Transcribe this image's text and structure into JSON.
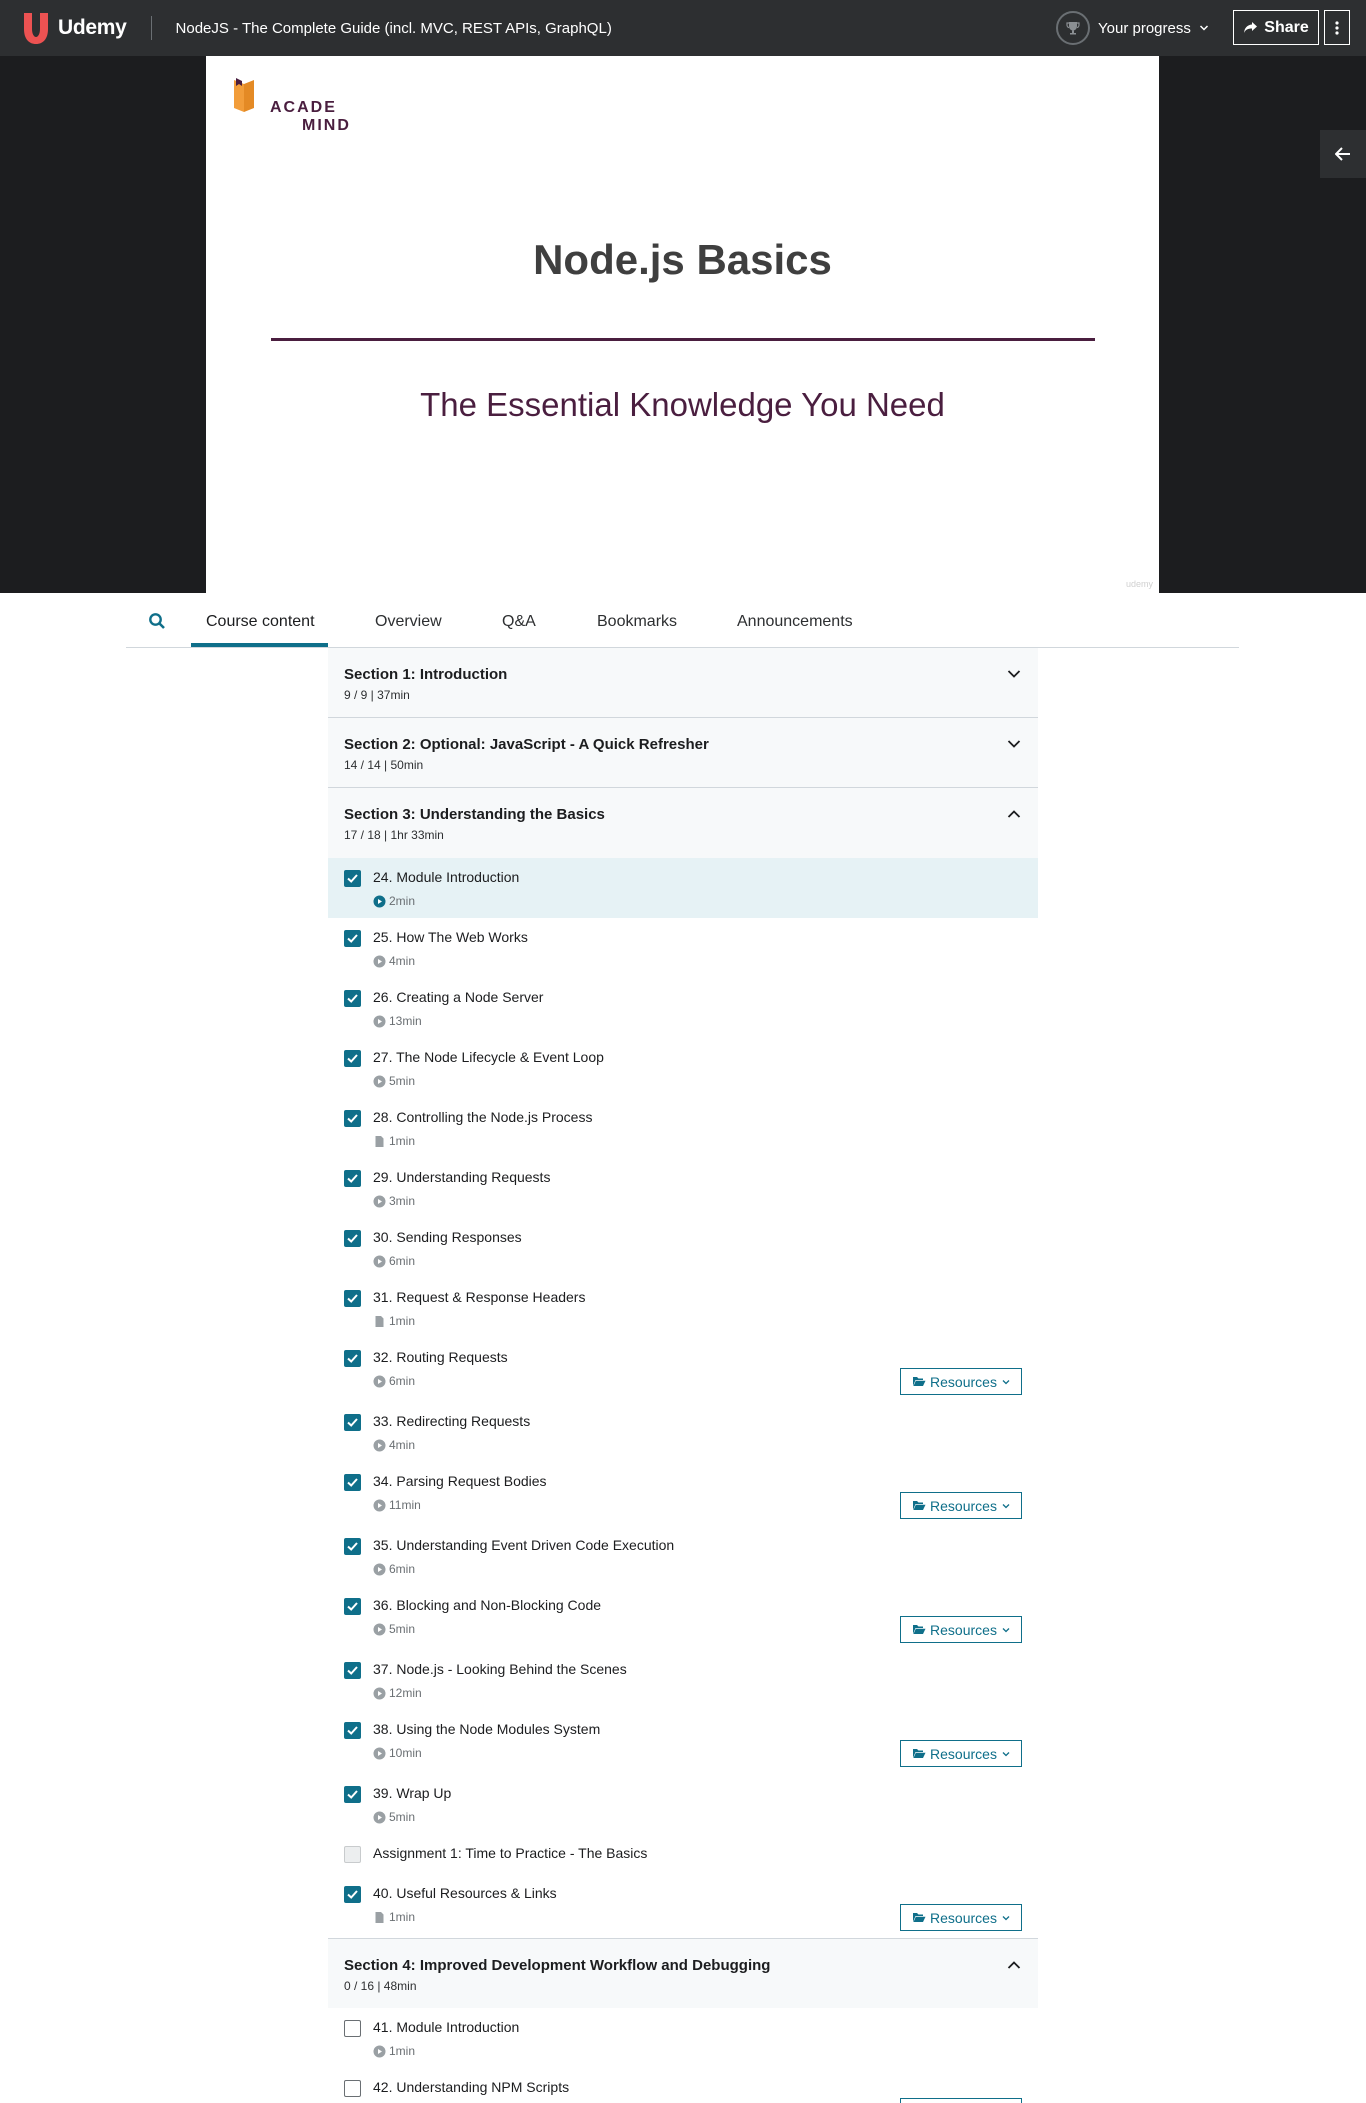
{
  "header": {
    "brand": "Udemy",
    "course_title": "NodeJS - The Complete Guide (incl. MVC, REST APIs, GraphQL)",
    "progress_label": "Your progress",
    "share_label": "Share"
  },
  "slide": {
    "logo_line1": "ACADE",
    "logo_line2": "MIND",
    "title": "Node.js Basics",
    "subtitle": "The Essential Knowledge You Need",
    "watermark": "udemy"
  },
  "tabs": [
    "Course content",
    "Overview",
    "Q&A",
    "Bookmarks",
    "Announcements"
  ],
  "sections": [
    {
      "title": "Section 1: Introduction",
      "meta": "9 / 9 | 37min",
      "expanded": false
    },
    {
      "title": "Section 2: Optional: JavaScript - A Quick Refresher",
      "meta": "14 / 14 | 50min",
      "expanded": false
    },
    {
      "title": "Section 3: Understanding the Basics",
      "meta": "17 / 18 | 1hr 33min",
      "expanded": true
    },
    {
      "title": "Section 4: Improved Development Workflow and Debugging",
      "meta": "0 / 16 | 48min",
      "expanded": true
    }
  ],
  "items": [
    {
      "title": "24. Module Introduction",
      "duration": "2min",
      "kind": "video",
      "checked": true,
      "current": true,
      "resources": false
    },
    {
      "title": "25. How The Web Works",
      "duration": "4min",
      "kind": "video",
      "checked": true,
      "resources": false
    },
    {
      "title": "26. Creating a Node Server",
      "duration": "13min",
      "kind": "video",
      "checked": true,
      "resources": false
    },
    {
      "title": "27. The Node Lifecycle & Event Loop",
      "duration": "5min",
      "kind": "video",
      "checked": true,
      "resources": false
    },
    {
      "title": "28. Controlling the Node.js Process",
      "duration": "1min",
      "kind": "article",
      "checked": true,
      "resources": false
    },
    {
      "title": "29. Understanding Requests",
      "duration": "3min",
      "kind": "video",
      "checked": true,
      "resources": false
    },
    {
      "title": "30. Sending Responses",
      "duration": "6min",
      "kind": "video",
      "checked": true,
      "resources": false
    },
    {
      "title": "31. Request & Response Headers",
      "duration": "1min",
      "kind": "article",
      "checked": true,
      "resources": false
    },
    {
      "title": "32. Routing Requests",
      "duration": "6min",
      "kind": "video",
      "checked": true,
      "resources": true
    },
    {
      "title": "33. Redirecting Requests",
      "duration": "4min",
      "kind": "video",
      "checked": true,
      "resources": false
    },
    {
      "title": "34. Parsing Request Bodies",
      "duration": "11min",
      "kind": "video",
      "checked": true,
      "resources": true
    },
    {
      "title": "35. Understanding Event Driven Code Execution",
      "duration": "6min",
      "kind": "video",
      "checked": true,
      "resources": false
    },
    {
      "title": "36. Blocking and Non-Blocking Code",
      "duration": "5min",
      "kind": "video",
      "checked": true,
      "resources": true
    },
    {
      "title": "37. Node.js - Looking Behind the Scenes",
      "duration": "12min",
      "kind": "video",
      "checked": true,
      "resources": false
    },
    {
      "title": "38. Using the Node Modules System",
      "duration": "10min",
      "kind": "video",
      "checked": true,
      "resources": true
    },
    {
      "title": "39. Wrap Up",
      "duration": "5min",
      "kind": "video",
      "checked": true,
      "resources": false
    },
    {
      "title": "Assignment 1: Time to Practice - The Basics",
      "duration": "",
      "kind": "assignment",
      "checked": false,
      "resources": false
    },
    {
      "title": "40. Useful Resources & Links",
      "duration": "1min",
      "kind": "article",
      "checked": true,
      "resources": true
    },
    {
      "title": "41. Module Introduction",
      "duration": "1min",
      "kind": "video",
      "checked": false,
      "resources": false
    },
    {
      "title": "42. Understanding NPM Scripts",
      "duration": "",
      "kind": "video",
      "checked": false,
      "resources": true
    }
  ],
  "resources_label": "Resources",
  "colors": {
    "accent": "#0f6f8a",
    "brand": "#a435f0",
    "slide_purple": "#4a1e3f",
    "header_bg": "#2d2f31"
  }
}
